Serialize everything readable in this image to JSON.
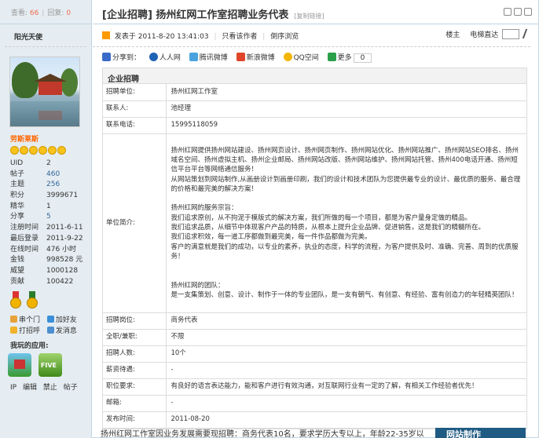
{
  "sidebar": {
    "views_label": "查看:",
    "views": "66",
    "replies_label": "回复:",
    "replies": "0",
    "username": "阳光天使",
    "rank": "劳斯莱斯",
    "stats": [
      {
        "k": "UID",
        "v": "2"
      },
      {
        "k": "帖子",
        "v": "460"
      },
      {
        "k": "主题",
        "v": "256"
      },
      {
        "k": "积分",
        "v": "3999671"
      },
      {
        "k": "精华",
        "v": "1"
      },
      {
        "k": "分享",
        "v": "5"
      },
      {
        "k": "注册时间",
        "v": "2011-6-11"
      },
      {
        "k": "最后登录",
        "v": "2011-9-22"
      },
      {
        "k": "在线时间",
        "v": "476 小时"
      },
      {
        "k": "金钱",
        "v": "998528 元"
      },
      {
        "k": "威望",
        "v": "1000128"
      },
      {
        "k": "贡献",
        "v": "100422"
      }
    ],
    "actions": {
      "visit": "串个门",
      "add_friend": "加好友",
      "greet": "打招呼",
      "message": "发消息"
    },
    "play_title": "我玩的应用:",
    "game2_label": "FIVE",
    "admin": {
      "ip": "IP",
      "edit": "编辑",
      "ban": "禁止",
      "posts": "帖子"
    }
  },
  "thread": {
    "title": "[企业招聘] 扬州红网工作室招聘业务代表",
    "copy_link": "[复制链接]",
    "posted": "发表于 2011-8-20 13:41:03",
    "only_author": "只看该作者",
    "reverse": "倒序浏览",
    "floor": "楼主",
    "jump": "电梯直达"
  },
  "share": {
    "label": "分享到：",
    "items": [
      "人人网",
      "腾讯微博",
      "新浪微博",
      "QQ空间",
      "更多"
    ],
    "count": "0"
  },
  "info": {
    "heading": "企业招聘",
    "rows": [
      {
        "k": "招聘单位:",
        "v": "扬州红网工作室"
      },
      {
        "k": "联系人:",
        "v": "池经理"
      },
      {
        "k": "联系电话:",
        "v": "15995118059"
      },
      {
        "k": "单位简介:",
        "v": "扬州红网提供扬州网站建设、扬州网页设计、扬州网页制作、扬州网站优化、扬州网站推广、扬州网站SEO排名、扬州域名空间、扬州虚拟主机、扬州企业邮局、扬州网站改版、扬州网站维护、扬州网站托管、扬州400电话开通、扬州短信平台平台等网络通信服务！\n从网站策划到网站制作,从画册设计到画册印刷，我们的设计和技术团队为您提供最专业的设计、最优质的服务、最合理的价格和最完美的解决方案！\n\n扬州红网的服务宗旨：\n我们追求原创，从不拘泥于模版式的解决方案，我们所做的每一个项目，都是为客户量身定做的精品。\n我们追求品质，从细节中体现客户产品的特质，从根本上提升企业品牌、促进销售，这是我们的精髓所在。\n我们追求积效，每一道工序都做到最完美，每一件作品都做为完美。\n客户的满意就是我们的成功，以专业的素养，执业的态度，科学的流程，为客户提供及时、准确、完善、周到的优质服务！\n\n\n扬州红网的团队：\n是一支集策划、创意、设计、制作于一体的专业团队，是一支有朝气、有创意、有经验、富有创造力的年轻精英团队！"
      },
      {
        "k": "招聘岗位:",
        "v": "商务代表"
      },
      {
        "k": "全职/兼职:",
        "v": "不限"
      },
      {
        "k": "招聘人数:",
        "v": "10个"
      },
      {
        "k": "薪资待遇:",
        "v": "-"
      },
      {
        "k": "职位要求:",
        "v": "有良好的语言表达能力，能和客户进行有效沟通，对互联网行业有一定的了解，有相关工作经验者优先！"
      },
      {
        "k": "邮箱:",
        "v": "-"
      },
      {
        "k": "发布时间:",
        "v": "2011-08-20"
      }
    ]
  },
  "bottom_text": "扬州红网工作室因业务发展需要现招聘：商务代表10名，要求学历大专以上，年龄22-35岁以",
  "banner_text": "网站制作",
  "colors": {
    "accent": "#336699",
    "sidebar_bg": "#e5edf2",
    "border": "#c2d5e3",
    "rank": "#ff6600"
  }
}
